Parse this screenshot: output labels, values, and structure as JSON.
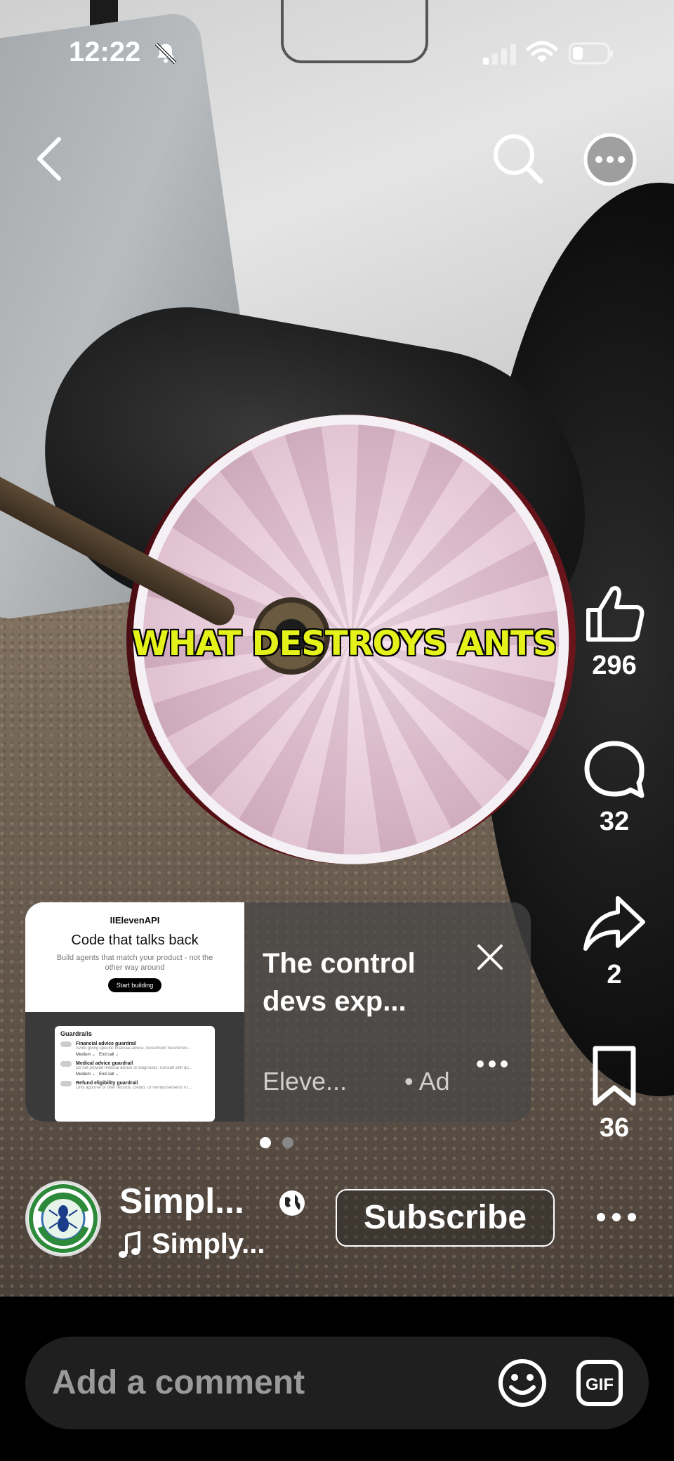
{
  "status_bar": {
    "time": "12:22",
    "icons": [
      "bell-slash-icon",
      "cellular-signal-icon",
      "wifi-icon",
      "battery-icon"
    ]
  },
  "top_nav": {
    "icons": [
      "back-chevron-icon",
      "search-icon",
      "more-circle-icon"
    ]
  },
  "video": {
    "caption": "WHAT DESTROYS ANTS",
    "caption_color": "#e4f21a"
  },
  "actions": {
    "like_count": "296",
    "comment_count": "32",
    "share_count": "2",
    "save_count": "36"
  },
  "ad": {
    "thumbnail": {
      "brand": "IIElevenAPI",
      "headline": "Code that talks back",
      "subtext": "Build agents that match your product - not the other way around",
      "cta": "Start building",
      "panel_title": "Guardrails",
      "guardrails": [
        {
          "name": "Financial advice guardrail",
          "desc": "Avoid giving specific financial advice, investment recommen...",
          "level": "Medium",
          "action": "End call"
        },
        {
          "name": "Medical advice guardrail",
          "desc": "Do not provide medical advice or diagnoses. Consult with qu...",
          "level": "Medium",
          "action": "End call"
        },
        {
          "name": "Refund eligibility guardrail",
          "desc": "Only approve or offer refunds, credits, or reimbursements if t...",
          "level": "",
          "action": ""
        }
      ]
    },
    "title": "The control devs exp...",
    "source": "Eleve...",
    "label": "• Ad",
    "page_index": 1,
    "page_count": 2
  },
  "channel": {
    "name": "Simpl...",
    "sound": "Simply...",
    "subscribe_label": "Subscribe",
    "avatar_text_top": "SIMPLY GREEN",
    "avatar_text_bottom": "PEST CONTROL"
  },
  "comment_bar": {
    "placeholder": "Add a comment",
    "gif_label": "GIF"
  },
  "colors": {
    "accent_caption": "#e4f21a",
    "background": "#000000",
    "comment_bar": "#1f1f1f"
  }
}
